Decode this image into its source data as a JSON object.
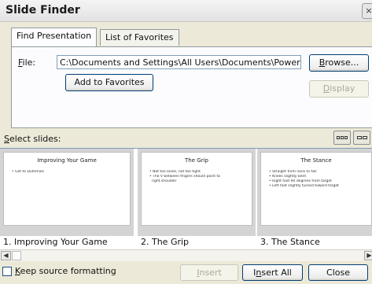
{
  "window": {
    "title": "Slide Finder",
    "close_glyph": "×"
  },
  "tabs": [
    {
      "label": "Find Presentation",
      "active": true
    },
    {
      "label": "List of Favorites",
      "active": false
    }
  ],
  "file": {
    "label_rest": "ile:",
    "label_underlined": "F",
    "path": "C:\\Documents and Settings\\All Users\\Documents\\PowerPoint"
  },
  "buttons": {
    "browse_rest": "rowse...",
    "browse_underlined": "B",
    "add_favorites": "Add to Favorites",
    "display_rest": "isplay",
    "display_underlined": "D",
    "insert_rest": "nsert",
    "insert_underlined": "I",
    "insert_all_pre": "I",
    "insert_all_underlined": "n",
    "insert_all_rest": "sert All",
    "close": "Close"
  },
  "select_slides": {
    "underlined": "S",
    "rest": "elect slides:"
  },
  "view_icons": [
    "slide-thumbnail-view-icon",
    "slide-list-view-icon"
  ],
  "slides": [
    {
      "thumb_title": "Improving Your Game",
      "bullets": [
        "Get to Dummies"
      ],
      "caption": "1. Improving Your Game"
    },
    {
      "thumb_title": "The Grip",
      "bullets": [
        "Not too loose, not too tight",
        "The V between fingers should point to",
        "right shoulder"
      ],
      "caption": "2. The Grip"
    },
    {
      "thumb_title": "The Stance",
      "bullets": [
        "Straight from neck to tail",
        "Knees slightly bent",
        "Right foot 90 degrees from target",
        "Left foot slightly turned toward target"
      ],
      "caption": "3. The Stance"
    }
  ],
  "scroll": {
    "left": "◀",
    "right": "▶"
  },
  "keep_source": {
    "underlined": "K",
    "rest": "eep source formatting",
    "checked": false
  }
}
